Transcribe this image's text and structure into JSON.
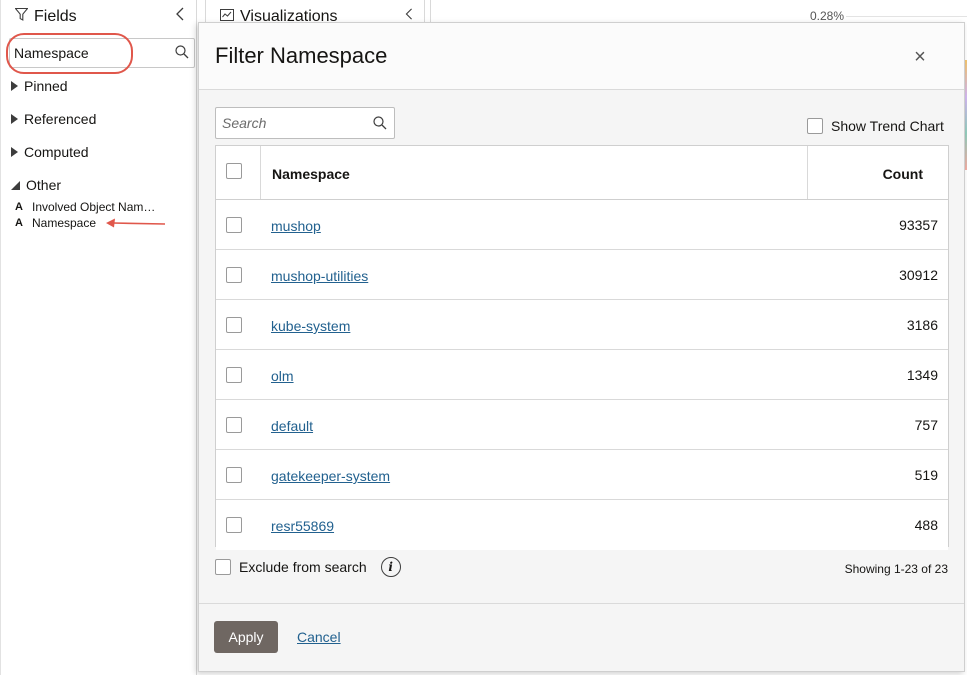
{
  "fields": {
    "title": "Fields",
    "search_value": "Namespace",
    "groups": [
      {
        "label": "Pinned",
        "expanded": false
      },
      {
        "label": "Referenced",
        "expanded": false
      },
      {
        "label": "Computed",
        "expanded": false
      },
      {
        "label": "Other",
        "expanded": true
      }
    ],
    "items": [
      {
        "type": "A",
        "label": "Involved Object Nam…"
      },
      {
        "type": "A",
        "label": "Namespace"
      }
    ]
  },
  "visualizations": {
    "title": "Visualizations",
    "percent_label": "0.28%"
  },
  "dialog": {
    "title": "Filter Namespace",
    "close_glyph": "×",
    "search_placeholder": "Search",
    "show_trend_label": "Show Trend Chart",
    "columns": {
      "namespace": "Namespace",
      "count": "Count"
    },
    "rows": [
      {
        "namespace": "mushop",
        "count": "93357"
      },
      {
        "namespace": "mushop-utilities",
        "count": "30912"
      },
      {
        "namespace": "kube-system",
        "count": "3186"
      },
      {
        "namespace": "olm",
        "count": "1349"
      },
      {
        "namespace": "default",
        "count": "757"
      },
      {
        "namespace": "gatekeeper-system",
        "count": "519"
      },
      {
        "namespace": "resr55869",
        "count": "488"
      }
    ],
    "exclude_label": "Exclude from search",
    "info_glyph": "i",
    "showing_text": "Showing 1-23 of 23",
    "apply_label": "Apply",
    "cancel_label": "Cancel"
  },
  "colors": {
    "link": "#22618f",
    "apply_button": "#6f6762",
    "annotation": "#e0574b"
  }
}
